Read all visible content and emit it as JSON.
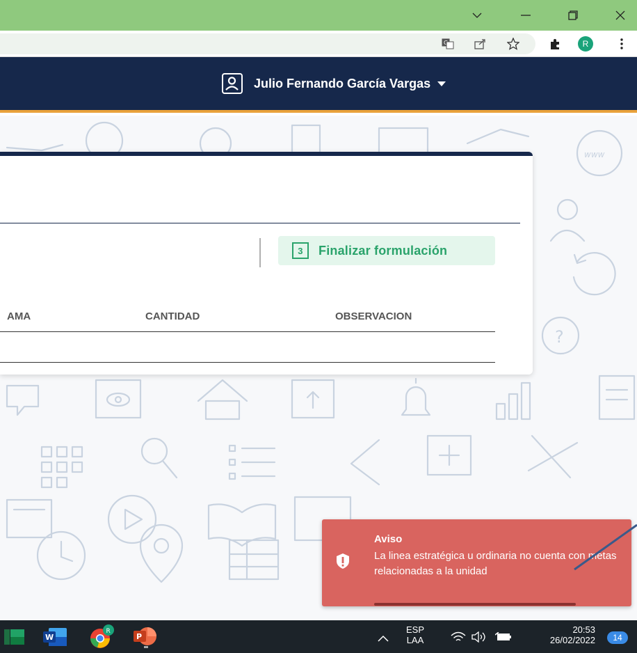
{
  "browser": {
    "window_controls": {
      "tab_search_icon": "chevron-down",
      "minimize_icon": "minimize",
      "restore_icon": "restore",
      "close_icon": "close"
    },
    "toolbar_icons": [
      "translate-icon",
      "share-icon",
      "bookmark-star-icon",
      "extensions-puzzle-icon",
      "profile-avatar",
      "kebab-menu-icon"
    ],
    "profile_initial": "R"
  },
  "header": {
    "user_name": "Julio Fernando García Vargas",
    "accent_color": "#e9a23b",
    "bg_color": "#16284b"
  },
  "card": {
    "finalize_button": "Finalizar formulación",
    "finalize_icon_number": "3",
    "columns": [
      "AMA",
      "CANTIDAD",
      "OBSERVACION"
    ]
  },
  "background_icons": [
    "www-icon",
    "user-icon",
    "refresh-icon",
    "help-icon",
    "eye-icon",
    "home-icon",
    "upload-icon",
    "bell-icon",
    "bar-chart-icon",
    "document-icon",
    "grid-icon",
    "search-icon",
    "list-icon",
    "add-icon",
    "scissors-icon",
    "play-icon",
    "book-icon",
    "clock-icon",
    "location-icon"
  ],
  "toast": {
    "title": "Aviso",
    "message": "La linea estratégica u ordinaria no cuenta con metas relacionadas a la unidad",
    "color": "#d9645f"
  },
  "taskbar": {
    "apps": [
      "excel-icon",
      "word-icon",
      "chrome-icon",
      "powerpoint-icon"
    ],
    "chrome_badge": "R",
    "language_top": "ESP",
    "language_bottom": "LAA",
    "time": "20:53",
    "date": "26/02/2022",
    "notifications": "14"
  }
}
